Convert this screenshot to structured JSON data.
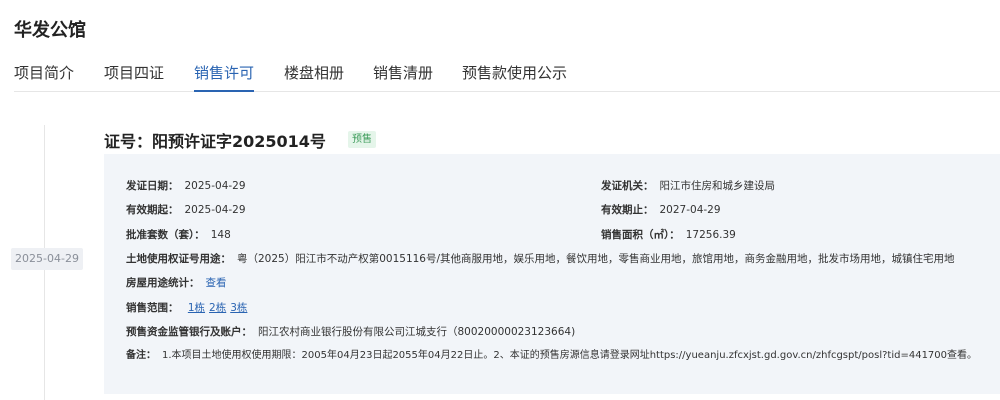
{
  "project": {
    "title": "华发公馆"
  },
  "tabs": [
    {
      "label": "项目简介",
      "active": false
    },
    {
      "label": "项目四证",
      "active": false
    },
    {
      "label": "销售许可",
      "active": true
    },
    {
      "label": "楼盘相册",
      "active": false
    },
    {
      "label": "销售清册",
      "active": false
    },
    {
      "label": "预售款使用公示",
      "active": false
    }
  ],
  "timeline": {
    "date": "2025-04-29"
  },
  "certificate": {
    "title": "证号：阳预许证字2025014号",
    "badge": "预售",
    "issue_date_label": "发证日期：",
    "issue_date": "2025-04-29",
    "issuer_label": "发证机关：",
    "issuer": "阳江市住房和城乡建设局",
    "valid_from_label": "有效期起：",
    "valid_from": "2025-04-29",
    "valid_to_label": "有效期止：",
    "valid_to": "2027-04-29",
    "units_label": "批准套数（套）：",
    "units": "148",
    "area_label": "销售面积（㎡）：",
    "area": "17256.39",
    "land_use_label": "土地使用权证号用途：",
    "land_use": "粤（2025）阳江市不动产权第0015116号/其他商服用地，娱乐用地，餐饮用地，零售商业用地，旅馆用地，商务金融用地，批发市场用地，城镇住宅用地",
    "usage_stats_label": "房屋用途统计：",
    "usage_stats_link": "查看",
    "sales_scope_label": "销售范围：",
    "sales_scope": [
      "1栋",
      "2栋",
      "3栋"
    ],
    "bank_label": "预售资金监管银行及账户：",
    "bank": "阳江农村商业银行股份有限公司江城支行（80020000023123664)",
    "remark_label": "备注：",
    "remark": "1.本项目土地使用权使用期限：2005年04月23日起2055年04月22日止。2、本证的预售房源信息请登录网址https://yueanju.zfcxjst.gd.gov.cn/zhfcgspt/posl?tid=441700查看。"
  }
}
